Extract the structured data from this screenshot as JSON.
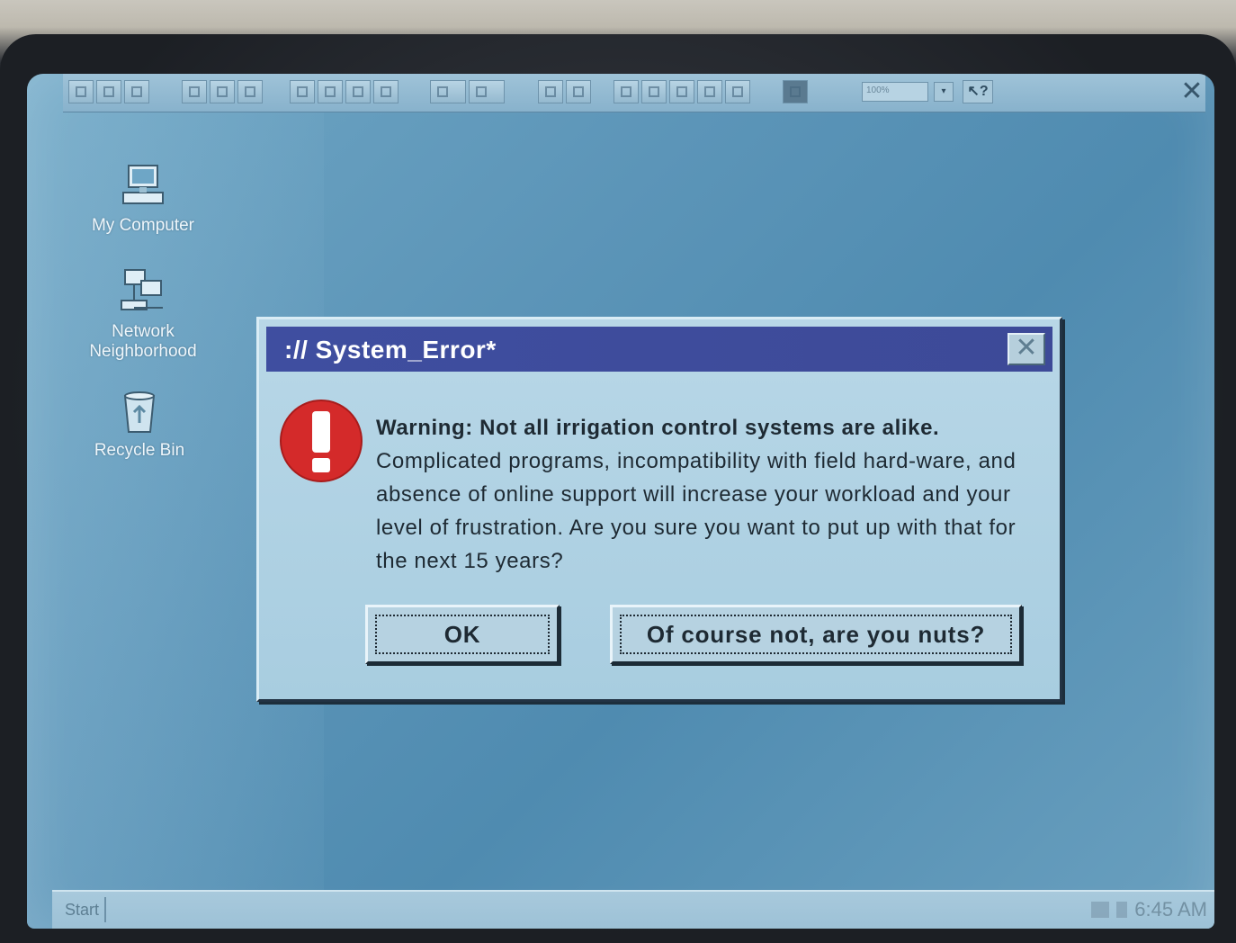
{
  "toolbar": {
    "zoom_value": "100%",
    "zoom_dropdown_glyph": "▾",
    "help_label": "↖?",
    "close_glyph": "✕"
  },
  "desktop_icons": [
    {
      "label": "My Computer",
      "icon": "computer-icon"
    },
    {
      "label": "Network Neighborhood",
      "icon": "network-icon"
    },
    {
      "label": "Recycle Bin",
      "icon": "recycle-bin-icon"
    }
  ],
  "dialog": {
    "title": "://  System_Error*",
    "close_glyph": "✕",
    "icon": "warning-icon",
    "heading": "Warning: Not all irrigation control systems are alike.",
    "body": "Complicated programs, incompatibility with field hard-ware, and absence of online support will increase your workload and your level of frustration. Are you sure you want to put up with that for the next 15 years?",
    "buttons": {
      "ok": "OK",
      "cancel": "Of course not, are you nuts?"
    }
  },
  "taskbar": {
    "start_label": "Start",
    "clock": "6:45 AM"
  },
  "colors": {
    "titlebar": "#3f4ea0",
    "desktop": "#5c95b8",
    "warning_red": "#d42a2a"
  }
}
